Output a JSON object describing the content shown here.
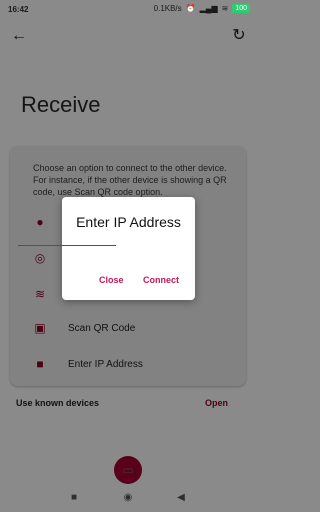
{
  "status_bar": {
    "time": "16:42",
    "network_speed": "0.1KB/s",
    "battery": "100"
  },
  "toolbar": {
    "back_icon": "arrow-left-icon",
    "refresh_icon": "refresh-icon"
  },
  "page": {
    "title": "Receive"
  },
  "card": {
    "description": "Choose an option to connect to the other device. For instance, if the other device is showing a QR code, use Scan QR code option.",
    "options": [
      {
        "icon": "help-icon",
        "label": ""
      },
      {
        "icon": "hotspot-icon",
        "label": ""
      },
      {
        "icon": "wifi-icon",
        "label": ""
      },
      {
        "icon": "qr-scan-icon",
        "label": "Scan QR Code"
      },
      {
        "icon": "ip-icon",
        "label": "Enter IP Address"
      }
    ]
  },
  "known_devices": {
    "label": "Use known devices",
    "action": "Open"
  },
  "dialog": {
    "title": "Enter IP Address",
    "input_value": "",
    "close_label": "Close",
    "connect_label": "Connect"
  },
  "colors": {
    "accent": "#c2185b",
    "scrim": "#8a8a8a"
  }
}
